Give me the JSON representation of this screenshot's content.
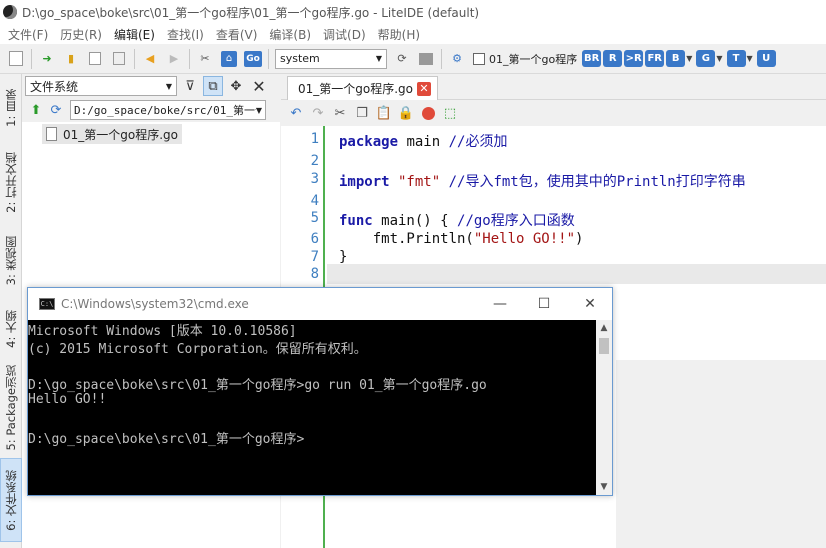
{
  "window": {
    "title": "D:\\go_space\\boke\\src\\01_第一个go程序\\01_第一个go程序.go - LiteIDE (default)"
  },
  "menu": [
    "文件(F)",
    "历史(R)",
    "编辑(E)",
    "查找(I)",
    "查看(V)",
    "编译(B)",
    "调试(D)",
    "帮助(H)"
  ],
  "toolbar": {
    "env_select": "system",
    "build_target": "01_第一个go程序",
    "badges": [
      "BR",
      "R",
      ">R",
      "FR",
      "B",
      "G",
      "T",
      "U"
    ],
    "colors": {
      "badge": "#3a78c8",
      "close": "#e04a3a",
      "gutter_line": "#4fb04f",
      "line_number": "#3f7fc0"
    }
  },
  "left_tabs": [
    "1: 目录",
    "2: 打开文档",
    "3: 类视图",
    "4: 大纲",
    "5: Package浏览",
    "6: 文件系统"
  ],
  "fs_panel": {
    "title": "文件系统",
    "path": "D:/go_space/boke/src/01_第一个",
    "file": "01_第一个go程序.go"
  },
  "editor": {
    "tab_label": "01_第一个go程序.go",
    "line_numbers": [
      "1",
      "2",
      "3",
      "4",
      "5",
      "6",
      "7",
      "8"
    ],
    "lines": [
      {
        "kw": "package",
        "rest": " main ",
        "comment": "//必须加"
      },
      {
        "kw": "",
        "rest": "",
        "comment": ""
      },
      {
        "kw": "import",
        "str": " \"fmt\" ",
        "comment": "//导入fmt包，使用其中的Println打印字符串"
      },
      {
        "kw": "",
        "rest": "",
        "comment": ""
      },
      {
        "kw": "func",
        "rest": " main() { ",
        "comment": "//go程序入口函数"
      },
      {
        "kw": "",
        "rest": "    fmt.Println(",
        "str": "\"Hello GO!!\"",
        "rest2": ")"
      },
      {
        "kw": "",
        "rest": "}",
        "comment": ""
      },
      {
        "kw": "",
        "rest": "",
        "comment": ""
      }
    ]
  },
  "cmd": {
    "title": "C:\\Windows\\system32\\cmd.exe",
    "output": [
      "Microsoft Windows [版本 10.0.10586]",
      "(c) 2015 Microsoft Corporation。保留所有权利。",
      "",
      "D:\\go_space\\boke\\src\\01_第一个go程序>go run 01_第一个go程序.go",
      "Hello GO!!",
      "",
      "D:\\go_space\\boke\\src\\01_第一个go程序>"
    ]
  }
}
